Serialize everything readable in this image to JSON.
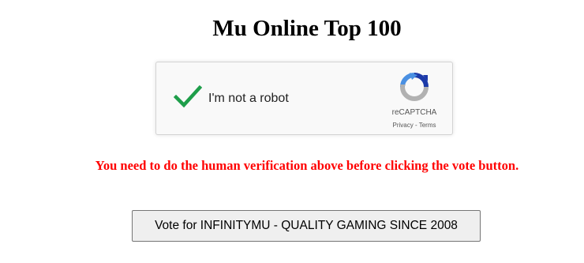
{
  "page": {
    "title": "Mu Online Top 100"
  },
  "captcha": {
    "label": "I'm not a robot",
    "checked": true,
    "brand": "reCAPTCHA",
    "privacy_link": "Privacy",
    "separator": " - ",
    "terms_link": "Terms",
    "colors": {
      "check": "#1e9e4a",
      "logo_blue": "#1c3aa9",
      "logo_light_blue": "#4a90e2",
      "logo_gray": "#b1b1b1"
    },
    "icons": {
      "check": "checkmark-icon",
      "logo": "recaptcha-logo-icon"
    }
  },
  "warning": {
    "text": "You need to do the human verification above before clicking the vote button.",
    "color": "#ff0000"
  },
  "vote": {
    "label": "Vote for INFINITYMU - QUALITY GAMING SINCE 2008"
  }
}
